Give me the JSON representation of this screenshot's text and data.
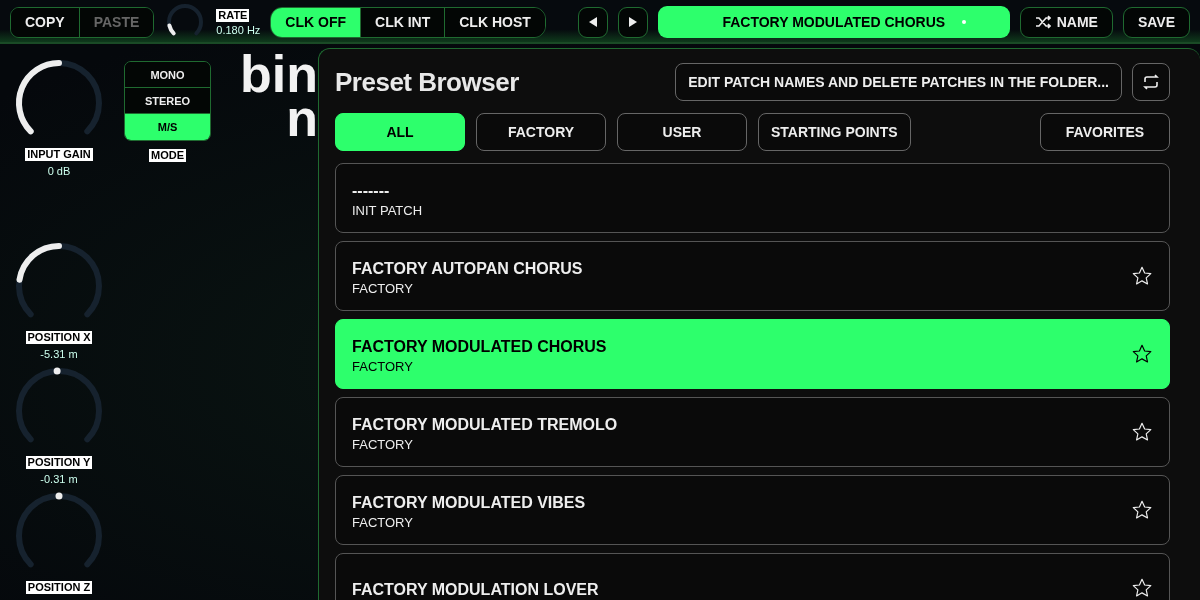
{
  "toolbar": {
    "copy": {
      "label": "COPY",
      "disabled": false
    },
    "paste": {
      "label": "PASTE",
      "disabled": true
    },
    "rate": {
      "label": "RATE",
      "reading": "0.180 Hz",
      "level": 0.12
    },
    "clock_modes": [
      {
        "label": "CLK OFF",
        "selected": true
      },
      {
        "label": "CLK INT",
        "selected": false
      },
      {
        "label": "CLK HOST",
        "selected": false
      }
    ],
    "preset_name": "FACTORY MODULATED CHORUS",
    "modified": true,
    "name_button": "NAME",
    "save_button": "SAVE"
  },
  "knobs": [
    {
      "label": "INPUT GAIN",
      "reading": "0 dB",
      "kind": "unipolar",
      "level": 0.5
    },
    {
      "label": "POSITION X",
      "reading": "-5.31 m",
      "kind": "bipolar",
      "level": 0.2
    },
    {
      "label": "POSITION Y",
      "reading": "-0.31 m",
      "kind": "bipolar",
      "level": 0.49
    },
    {
      "label": "POSITION Z",
      "kind": "bipolar",
      "level": 0.5
    }
  ],
  "mode": {
    "label": "MODE",
    "options": [
      {
        "label": "MONO",
        "selected": false
      },
      {
        "label": "STEREO",
        "selected": false
      },
      {
        "label": "M/S",
        "selected": true
      }
    ]
  },
  "logo": [
    "bin",
    "n"
  ],
  "preset_browser": {
    "title": "Preset Browser",
    "edit_button": "EDIT PATCH NAMES AND DELETE PATCHES IN THE FOLDER...",
    "filters": [
      {
        "label": "ALL",
        "selected": true
      },
      {
        "label": "FACTORY",
        "selected": false
      },
      {
        "label": "USER",
        "selected": false
      },
      {
        "label": "STARTING POINTS",
        "selected": false
      }
    ],
    "favorites_filter": {
      "label": "FAVORITES",
      "selected": false
    },
    "presets": [
      {
        "name": "-------",
        "folder": "INIT PATCH",
        "selected": false
      },
      {
        "name": "FACTORY AUTOPAN CHORUS",
        "folder": "FACTORY",
        "selected": false,
        "favorite": false
      },
      {
        "name": "FACTORY MODULATED CHORUS",
        "folder": "FACTORY",
        "selected": true,
        "favorite": false
      },
      {
        "name": "FACTORY MODULATED TREMOLO",
        "folder": "FACTORY",
        "selected": false,
        "favorite": false
      },
      {
        "name": "FACTORY MODULATED VIBES",
        "folder": "FACTORY",
        "selected": false,
        "favorite": false
      },
      {
        "name": "FACTORY MODULATION LOVER",
        "selected": false,
        "favorite": false
      }
    ]
  }
}
